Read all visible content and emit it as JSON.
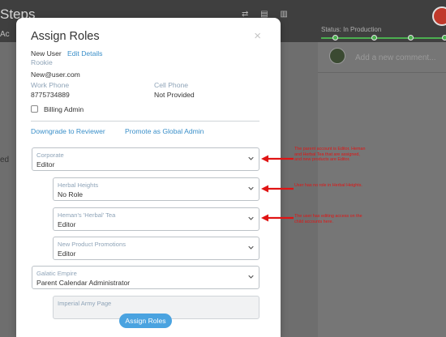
{
  "background": {
    "title": "Steps",
    "subtitle": "Ac",
    "status_label": "Status: In Production",
    "left_letter": "ed",
    "comment_placeholder": "Add a new comment...",
    "toolbar_icons": "⇄ ▤ ▥"
  },
  "modal": {
    "title": "Assign Roles",
    "close_label": "×",
    "user": {
      "name": "New User",
      "edit_label": "Edit Details",
      "role": "Rookie",
      "email": "New@user.com",
      "work_phone_label": "Work Phone",
      "work_phone": "8775734889",
      "cell_phone_label": "Cell Phone",
      "cell_phone": "Not Provided"
    },
    "billing_admin_label": "Billing Admin",
    "downgrade_label": "Downgrade to Reviewer",
    "promote_label": "Promote as Global Admin",
    "roles": [
      {
        "label": "Corporate",
        "value": "Editor"
      },
      {
        "label": "Herbal Heights",
        "value": "No Role"
      },
      {
        "label": "Heman's 'Herbal' Tea",
        "value": "Editor"
      },
      {
        "label": "New Product Promotions",
        "value": "Editor"
      },
      {
        "label": "Galatic Empire",
        "value": "Parent Calendar Administrator"
      },
      {
        "label": "Imperial Army Page",
        "value": ""
      }
    ],
    "assign_button_label": "Assign Roles"
  },
  "annotations": [
    {
      "text": "The parent account is Editor. Heman and Herbal Tea that are assigned, and new products are Editor."
    },
    {
      "text": "User has no role in Herbal Heights."
    },
    {
      "text": "The user has editing access on the child accounts here."
    }
  ],
  "colors": {
    "link": "#3a8fc9",
    "primary_button": "#4aa3e0",
    "annotation": "#e01414",
    "status_track": "#4caf50"
  }
}
